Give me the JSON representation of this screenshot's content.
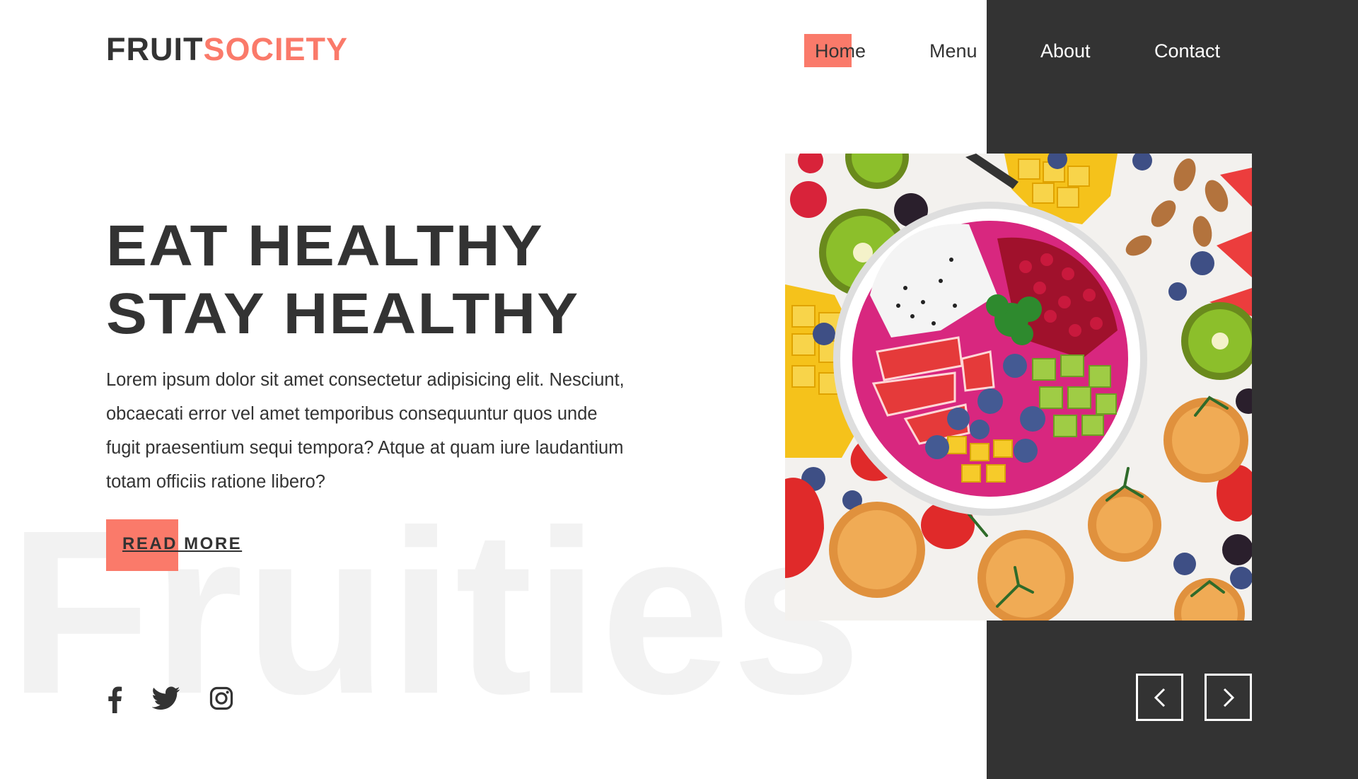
{
  "brand": {
    "part1": "FRUIT",
    "part2": "SOCIETY"
  },
  "nav": {
    "items": [
      "Home",
      "Menu",
      "About",
      "Contact"
    ]
  },
  "hero": {
    "headline_line1": "EAT HEALTHY",
    "headline_line2": "STAY HEALTHY",
    "description": "Lorem ipsum dolor sit amet consectetur adipisicing elit. Nesciunt, obcaecati error vel amet temporibus consequuntur quos unde fugit praesentium sequi tempora? Atque at quam iure laudantium totam officiis ratione libero?",
    "cta_label": "READ MORE",
    "watermark": "Fruities"
  },
  "social": [
    "facebook-icon",
    "twitter-icon",
    "instagram-icon"
  ],
  "carousel": {
    "prev_icon": "chevron-left-icon",
    "next_icon": "chevron-right-icon"
  },
  "colors": {
    "accent": "#fa7a6a",
    "dark": "#333333",
    "text": "#333333",
    "watermark": "#f2f2f2"
  }
}
